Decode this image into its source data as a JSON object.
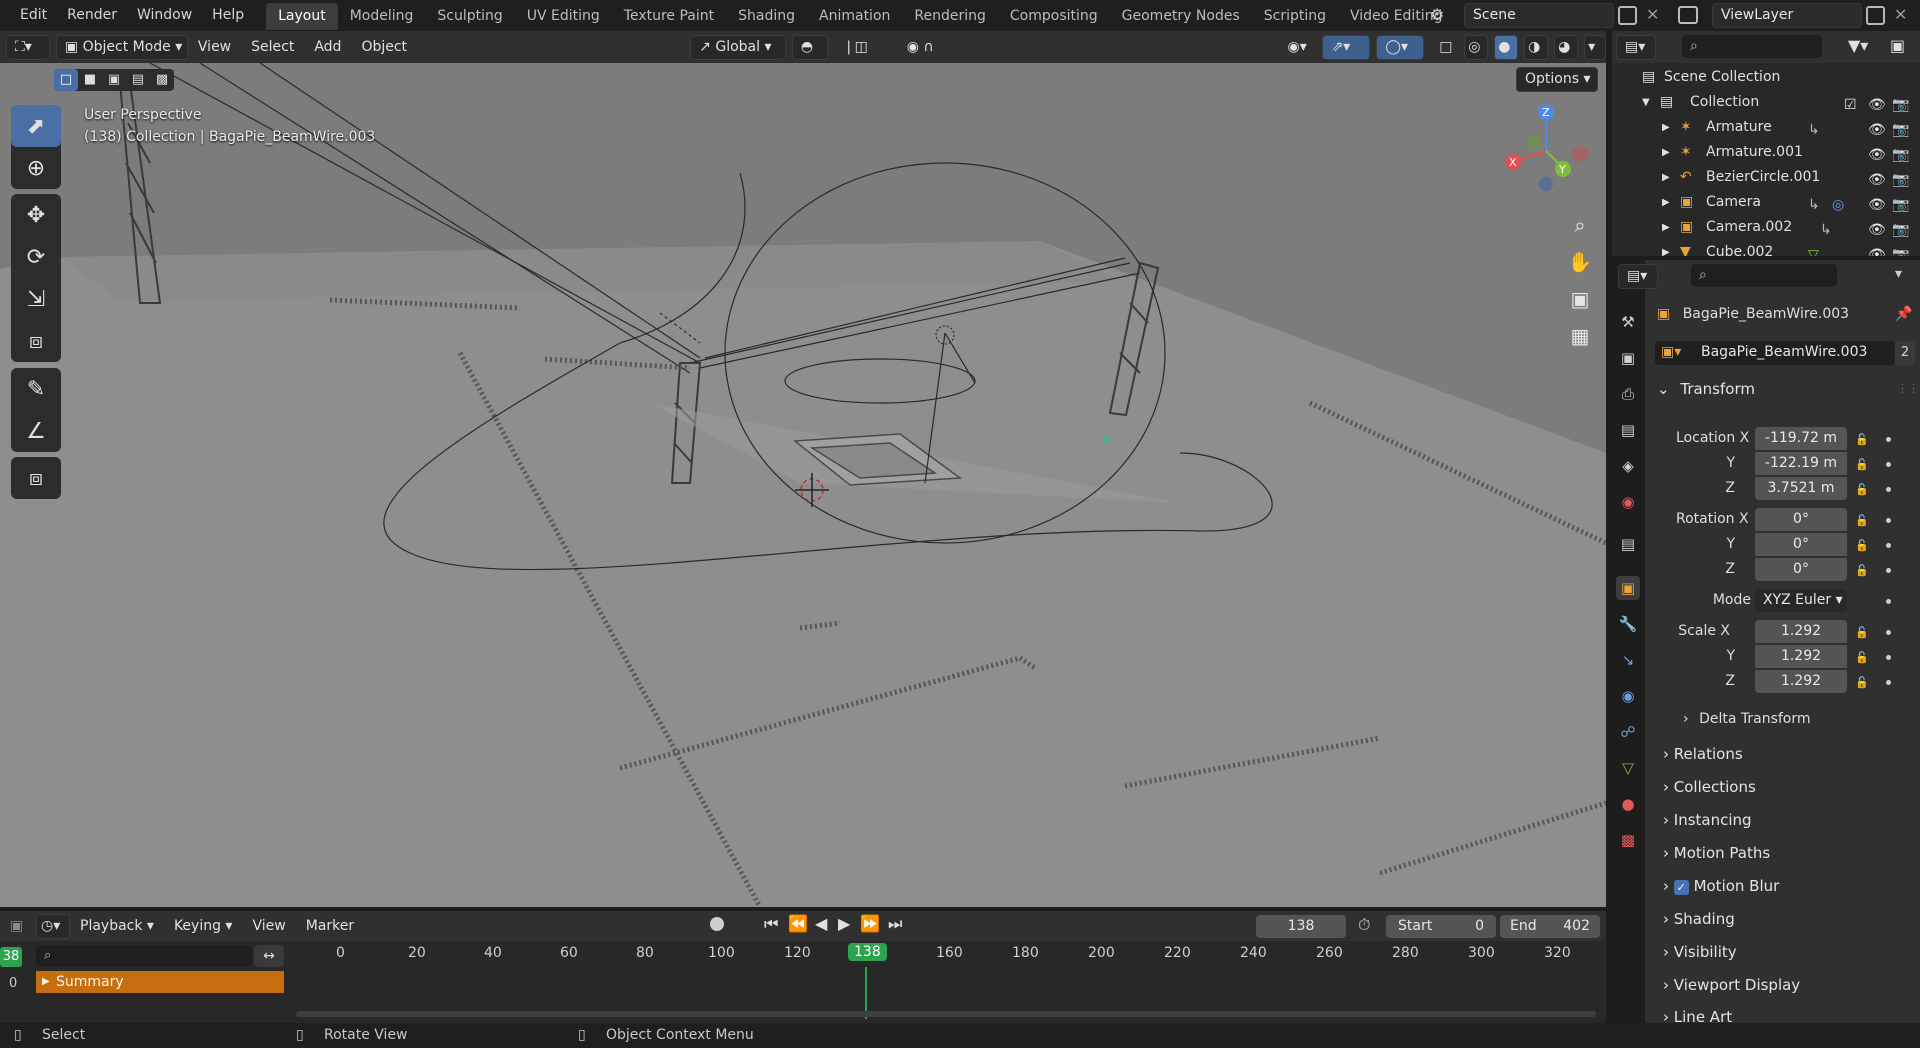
{
  "top_menu": {
    "items": [
      "Edit",
      "Render",
      "Window",
      "Help"
    ],
    "workspaces": [
      "Layout",
      "Modeling",
      "Sculpting",
      "UV Editing",
      "Texture Paint",
      "Shading",
      "Animation",
      "Rendering",
      "Compositing",
      "Geometry Nodes",
      "Scripting",
      "Video Editing"
    ],
    "add_tab": "+",
    "scene": "Scene",
    "view_layer": "ViewLayer"
  },
  "viewport_header": {
    "mode": "Object Mode",
    "menus": [
      "View",
      "Select",
      "Add",
      "Object"
    ],
    "orientation": "Global",
    "options": "Options"
  },
  "viewport": {
    "perspective": "User Perspective",
    "context": "(138) Collection | BagaPie_BeamWire.003",
    "gizmo": {
      "x": "X",
      "y": "Y",
      "z": "Z"
    },
    "background_color": "#8a8a8a"
  },
  "timeline": {
    "menus": [
      "Playback",
      "Keying",
      "View",
      "Marker"
    ],
    "current_frame": "138",
    "start_label": "Start",
    "start": "0",
    "end_label": "End",
    "end": "402",
    "ruler": [
      "0",
      "20",
      "40",
      "60",
      "80",
      "100",
      "120",
      "138",
      "160",
      "180",
      "200",
      "220",
      "240",
      "260",
      "280",
      "300",
      "320"
    ],
    "left_frame": "38",
    "left_zero": "0",
    "summary": "Summary"
  },
  "statusbar": {
    "select": "Select",
    "rotate": "Rotate View",
    "context_menu": "Object Context Menu"
  },
  "outliner": {
    "scene_collection": "Scene Collection",
    "collection": "Collection",
    "items": [
      {
        "name": "Armature",
        "icon": "armature-icon"
      },
      {
        "name": "Armature.001",
        "icon": "armature-icon"
      },
      {
        "name": "BezierCircle.001",
        "icon": "curve-icon"
      },
      {
        "name": "Camera",
        "icon": "camera-icon"
      },
      {
        "name": "Camera.002",
        "icon": "camera-icon"
      },
      {
        "name": "Cube.002",
        "icon": "mesh-icon"
      }
    ]
  },
  "properties": {
    "object_name": "BagaPie_BeamWire.003",
    "datablock": "BagaPie_BeamWire.003",
    "users": "2",
    "transform": {
      "title": "Transform",
      "location_label": "Location X",
      "location": [
        "-119.72 m",
        "-122.19 m",
        "3.7521 m"
      ],
      "rotation_label": "Rotation X",
      "rotation": [
        "0°",
        "0°",
        "0°"
      ],
      "mode_label": "Mode",
      "mode": "XYZ Euler",
      "scale_label": "Scale X",
      "scale": [
        "1.292",
        "1.292",
        "1.292"
      ],
      "axis_y": "Y",
      "axis_z": "Z"
    },
    "delta_transform": "Delta Transform",
    "panels": [
      "Relations",
      "Collections",
      "Instancing",
      "Motion Paths",
      "Motion Blur",
      "Shading",
      "Visibility",
      "Viewport Display",
      "Line Art"
    ],
    "motion_blur_checked": true
  },
  "colors": {
    "accent": "#4772b3",
    "active_object": "#e8a33a",
    "summary": "#c66d10",
    "playhead": "#2aa44f"
  }
}
